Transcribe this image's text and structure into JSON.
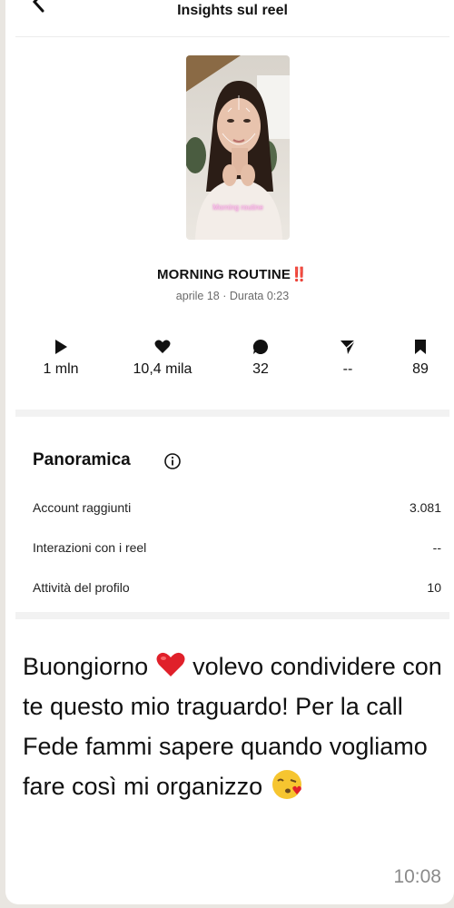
{
  "header": {
    "title": "Insights sul reel",
    "back_icon": "chevron-left-icon"
  },
  "reel": {
    "thumbnail_caption": "Morning routine",
    "title": "MORNING ROUTINE",
    "title_suffix": "‼️",
    "meta": "aprile 18 · Durata 0:23"
  },
  "stats": [
    {
      "icon": "play-icon",
      "value": "1 mln"
    },
    {
      "icon": "heart-icon",
      "value": "10,4 mila"
    },
    {
      "icon": "comment-icon",
      "value": "32"
    },
    {
      "icon": "send-icon",
      "value": "--"
    },
    {
      "icon": "bookmark-icon",
      "value": "89"
    }
  ],
  "overview": {
    "title": "Panoramica",
    "info_icon": "info-icon",
    "rows": [
      {
        "label": "Account raggiunti",
        "value": "3.081"
      },
      {
        "label": "Interazioni con i reel",
        "value": "--"
      },
      {
        "label": "Attività del profilo",
        "value": "10"
      }
    ]
  },
  "message": {
    "part1": "Buongiorno ",
    "emoji1": "red-heart-emoji",
    "part2": " volevo condividere con te questo mio traguardo! Per la call Fede fammi sapere quando vogliamo fare così mi organizzo ",
    "emoji2": "face-blowing-kiss-emoji",
    "time": "10:08"
  },
  "colors": {
    "accent_red": "#e02424",
    "muted_text": "#6b6b6b",
    "chat_background": "#e9e6e1"
  }
}
